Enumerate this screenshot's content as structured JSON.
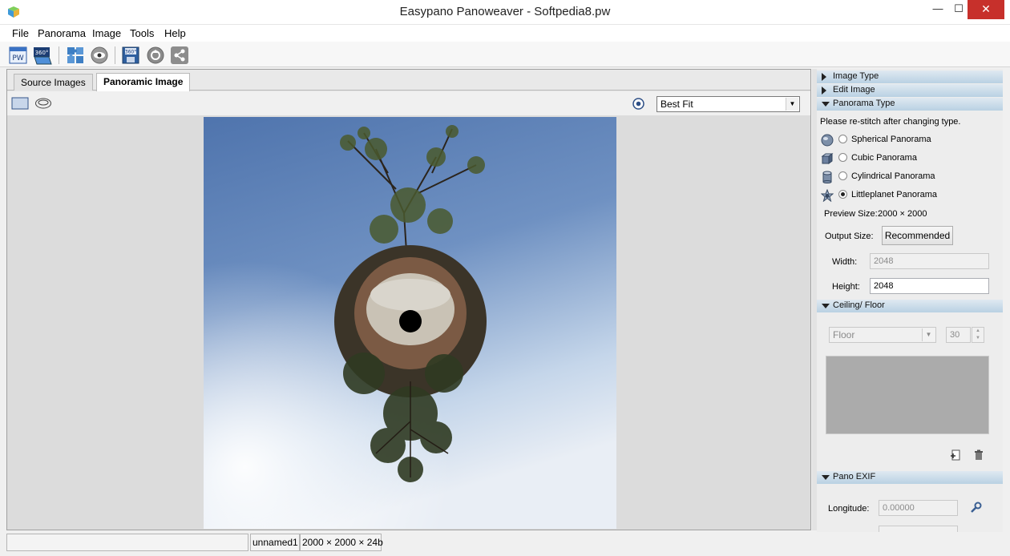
{
  "window": {
    "title": "Easypano Panoweaver - Softpedia8.pw",
    "min": "—",
    "max": "☐",
    "close": "✕"
  },
  "menu": [
    "File",
    "Panorama",
    "Image",
    "Tools",
    "Help"
  ],
  "toolbar": {
    "pw_label": "PW",
    "b360_label": "360°"
  },
  "tabs": [
    {
      "label": "Source Images",
      "active": false
    },
    {
      "label": "Panoramic Image",
      "active": true
    }
  ],
  "view": {
    "zoom_value": "Best Fit"
  },
  "panel": {
    "sections": {
      "image_type": "Image Type",
      "edit_image": "Edit Image",
      "panorama_type": "Panorama Type",
      "ceiling_floor": "Ceiling/ Floor",
      "pano_exif": "Pano EXIF"
    },
    "restitch_note": "Please re-stitch after changing type.",
    "types": [
      {
        "label": "Spherical Panorama",
        "icon": "sphere-icon",
        "selected": false
      },
      {
        "label": "Cubic Panorama",
        "icon": "cube-icon",
        "selected": false
      },
      {
        "label": "Cylindrical Panorama",
        "icon": "cylinder-icon",
        "selected": false
      },
      {
        "label": "Littleplanet Panorama",
        "icon": "star-planet-icon",
        "selected": true
      }
    ],
    "preview_size_label": "Preview Size:",
    "preview_size_value": "2000 × 2000",
    "output_size_label": "Output Size:",
    "recommended_label": "Recommended",
    "width_label": "Width:",
    "width_value": "2048",
    "height_label": "Height:",
    "height_value": "2048",
    "ceiling_select": "Floor",
    "ceiling_number": "30",
    "longitude_label": "Longitude:",
    "longitude_value": "0.00000"
  },
  "status": {
    "file": "unnamed1",
    "info": "2000 × 2000 × 24b"
  },
  "colors": {
    "accent": "#b9d1e3",
    "close": "#c7302b",
    "sky": "#5f82b8"
  }
}
